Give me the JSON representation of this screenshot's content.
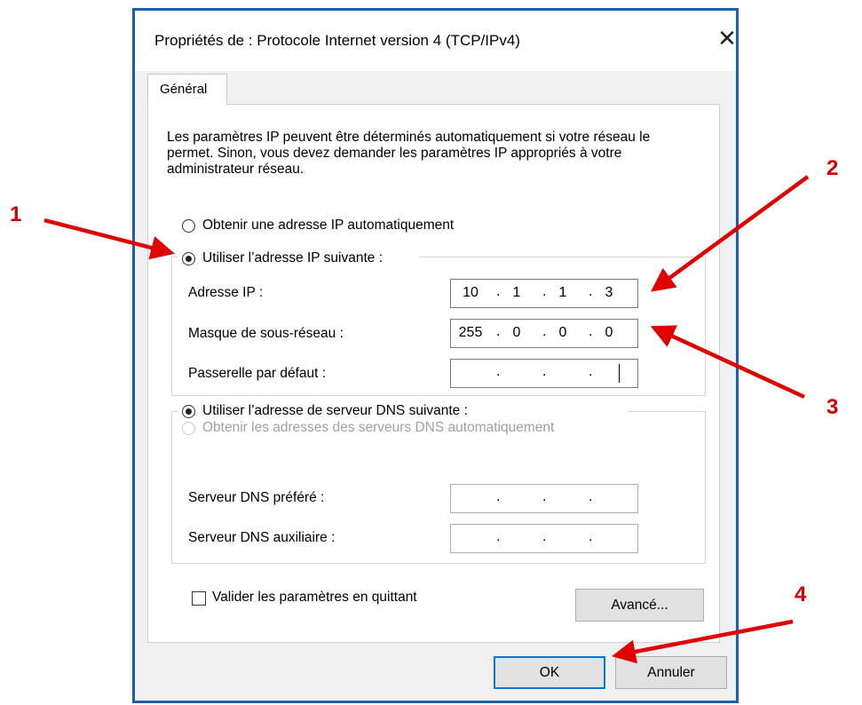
{
  "window": {
    "title": "Propriétés de : Protocole Internet version 4 (TCP/IPv4)",
    "close_label": "✕"
  },
  "tabs": [
    {
      "label": "Général",
      "active": true
    }
  ],
  "description": "Les paramètres IP peuvent être déterminés automatiquement si votre réseau le permet. Sinon, vous devez demander les paramètres IP appropriés à votre administrateur réseau.",
  "ip": {
    "auto_label": "Obtenir une adresse IP automatiquement",
    "auto_selected": false,
    "manual_label": "Utiliser l’adresse IP suivante :",
    "manual_selected": true,
    "address": {
      "label": "Adresse IP :",
      "octets": [
        "10",
        "1",
        "1",
        "3"
      ]
    },
    "mask": {
      "label": "Masque de sous-réseau :",
      "octets": [
        "255",
        "0",
        "0",
        "0"
      ]
    },
    "gateway": {
      "label": "Passerelle par défaut :",
      "octets": [
        "",
        "",
        "",
        ""
      ]
    }
  },
  "dns": {
    "auto_label": "Obtenir les adresses des serveurs DNS automatiquement",
    "auto_enabled": false,
    "manual_label": "Utiliser l’adresse de serveur DNS suivante :",
    "manual_selected": true,
    "preferred": {
      "label": "Serveur DNS préféré :",
      "octets": [
        "",
        "",
        "",
        ""
      ]
    },
    "alternate": {
      "label": "Serveur DNS auxiliaire :",
      "octets": [
        "",
        "",
        "",
        ""
      ]
    }
  },
  "validate_on_exit": {
    "label": "Valider les paramètres en quittant",
    "checked": false
  },
  "buttons": {
    "advanced": "Avancé...",
    "ok": "OK",
    "cancel": "Annuler"
  },
  "callouts": {
    "one": "1",
    "two": "2",
    "three": "3",
    "four": "4",
    "color": "#e00000"
  },
  "colors": {
    "window_border": "#1f5ea8",
    "default_button_border": "#0078d7"
  }
}
